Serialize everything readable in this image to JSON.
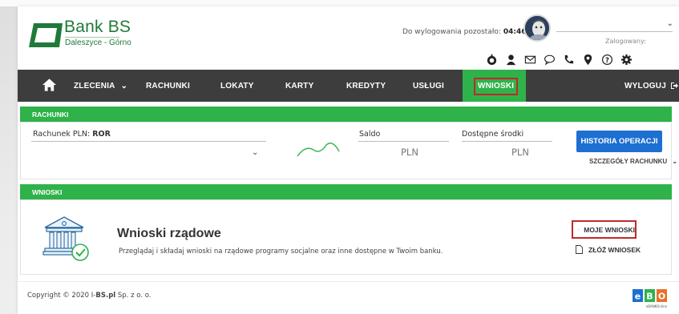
{
  "brand": {
    "name": "Bank BS",
    "sub": "Daleszyce - Górno",
    "color": "#1f7a3a"
  },
  "session": {
    "timer_label": "Do wylogowania pozostało:",
    "timer_value": "04:46",
    "logged_label": "Zalogowany:"
  },
  "header_icons": [
    "balance-icon",
    "user-icon",
    "mail-icon",
    "chat-icon",
    "phone-icon",
    "location-icon",
    "help-icon",
    "settings-icon"
  ],
  "nav": {
    "items": [
      {
        "label": "ZLECENIA"
      },
      {
        "label": "RACHUNKI"
      },
      {
        "label": "LOKATY"
      },
      {
        "label": "KARTY"
      },
      {
        "label": "KREDYTY"
      },
      {
        "label": "USŁUGI"
      },
      {
        "label": "WNIOSKI"
      }
    ],
    "logout_label": "WYLOGUJ",
    "accent": "#2fb24a",
    "highlight": "#c0282b"
  },
  "rachunki": {
    "header": "RACHUNKI",
    "account_label": "Rachunek PLN:",
    "account_value": "ROR",
    "saldo_label": "Saldo",
    "saldo_currency": "PLN",
    "dostepne_label": "Dostępne środki",
    "dostepne_currency": "PLN",
    "history_button": "HISTORIA OPERACJI",
    "details_link": "SZCZEGÓŁY RACHUNKU"
  },
  "wnioski": {
    "header": "WNIOSKI",
    "title": "Wnioski rządowe",
    "description": "Przeglądaj i składaj wnioski na rządowe programy socjalne oraz inne dostępne w Twoim banku.",
    "my_requests": "MOJE WNIOSKI",
    "submit_request": "ZŁÓŻ WNIOSEK"
  },
  "footer": {
    "copyright_prefix": "Copyright © 2020 I-",
    "copyright_bold": "BS.pl",
    "copyright_suffix": "Sp. z o. o.",
    "ebo_caption": "eBANKOnline"
  }
}
